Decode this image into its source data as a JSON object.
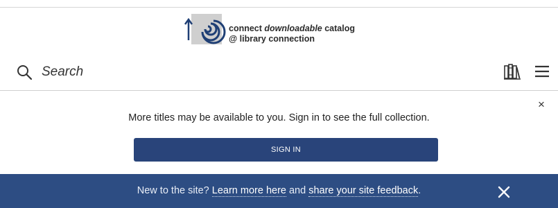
{
  "logo": {
    "line1_prefix": "connect ",
    "line1_emphasis": "downloadable",
    "line1_suffix": " catalog",
    "line2": "@ library connection"
  },
  "header": {
    "search_label": "Search",
    "search_icon": "search-icon",
    "shelf_icon": "books-icon",
    "menu_icon": "hamburger-menu-icon"
  },
  "signin_prompt": {
    "message": "More titles may be available to you. Sign in to see the full collection.",
    "button_label": "SIGN IN",
    "close_label": "×"
  },
  "banner": {
    "text_before": "New to the site? ",
    "link1": "Learn more here",
    "text_middle": " and ",
    "link2": "share your site feedback",
    "text_after": ".",
    "close_icon": "close-icon"
  },
  "colors": {
    "button_bg": "#29447a",
    "banner_bg": "#2d4d83",
    "text": "#222222"
  }
}
